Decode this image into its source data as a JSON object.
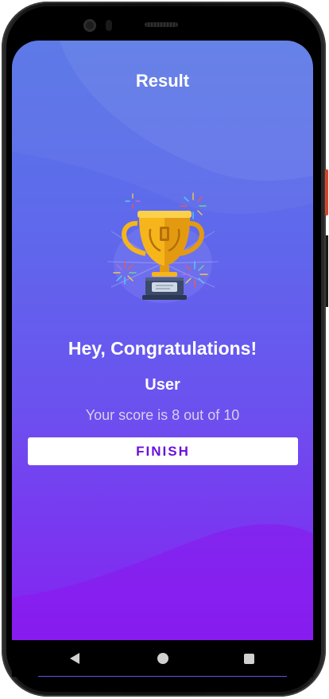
{
  "app": {
    "title": "Result"
  },
  "result": {
    "congrats": "Hey, Congratulations!",
    "username": "User",
    "score_text": "Your score is 8 out of 10",
    "finish_label": "FINISH"
  },
  "icons": {
    "trophy": "trophy-icon",
    "back": "back-icon",
    "home": "home-icon",
    "recents": "recents-icon"
  },
  "colors": {
    "background_top": "#5775e6",
    "background_bottom": "#8522f0",
    "button_text": "#6a11d8",
    "trophy_gold": "#f6b51b"
  }
}
